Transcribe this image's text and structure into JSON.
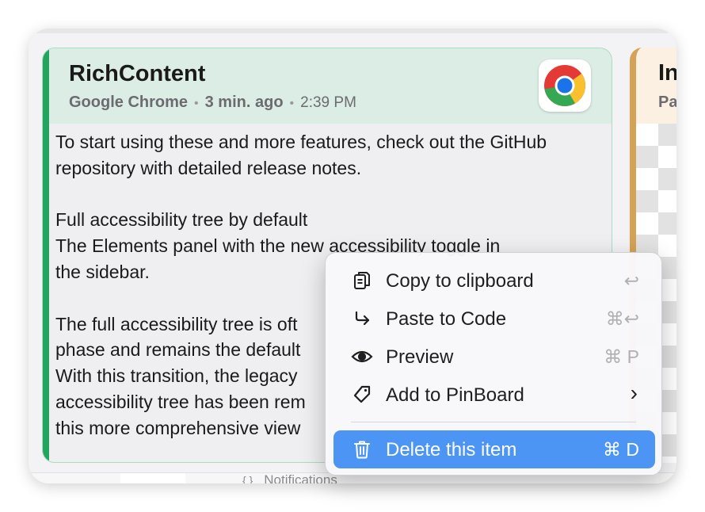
{
  "card": {
    "title": "RichContent",
    "app_name": "Google Chrome",
    "relative_time": "3 min. ago",
    "time": "2:39 PM",
    "app_icon": "chrome-icon",
    "body": "To start using these and more features, check out the GitHub\nrepository with detailed release notes.\n\nFull accessibility tree by default\nThe Elements panel with the new accessibility toggle in\nthe sidebar.\n\nThe full accessibility tree is oft\nphase and remains the default\nWith this transition, the legacy\naccessibility tree has been rem\nthis more comprehensive view"
  },
  "card2": {
    "title": "In",
    "subtitle": "Pa"
  },
  "background": {
    "notifications_label": "Notifications",
    "notifications_icon": "{ }"
  },
  "context_menu": {
    "items": [
      {
        "label": "Copy to clipboard",
        "shortcut": "↩",
        "icon": "clipboard-icon"
      },
      {
        "label": "Paste to Code",
        "shortcut": "⌘↩",
        "icon": "paste-arrow-icon"
      },
      {
        "label": "Preview",
        "shortcut": "⌘ P",
        "icon": "eye-icon"
      },
      {
        "label": "Add to PinBoard",
        "shortcut": "›",
        "icon": "tag-icon"
      },
      {
        "label": "Delete this item",
        "shortcut": "⌘ D",
        "icon": "trash-icon",
        "selected": true
      }
    ]
  },
  "colors": {
    "card_accent": "#23a55f",
    "card2_accent": "#d6a256",
    "selection": "#4c95f5"
  }
}
